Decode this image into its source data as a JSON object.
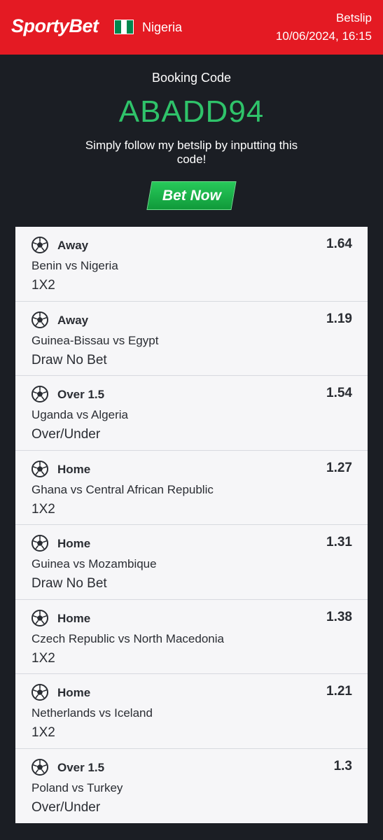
{
  "header": {
    "logo": "SportyBet",
    "country": "Nigeria",
    "title": "Betslip",
    "datetime": "10/06/2024, 16:15"
  },
  "booking": {
    "label": "Booking Code",
    "code": "ABADD94",
    "description": "Simply follow my betslip by inputting this code!",
    "button_label": "Bet Now"
  },
  "colors": {
    "brand_red": "#e41a23",
    "code_green": "#2fc36a",
    "background": "#1b1e24"
  },
  "bets": [
    {
      "pick": "Away",
      "odds": "1.64",
      "match": "Benin vs Nigeria",
      "market": "1X2"
    },
    {
      "pick": "Away",
      "odds": "1.19",
      "match": "Guinea-Bissau vs Egypt",
      "market": "Draw No Bet"
    },
    {
      "pick": "Over 1.5",
      "odds": "1.54",
      "match": "Uganda vs Algeria",
      "market": "Over/Under"
    },
    {
      "pick": "Home",
      "odds": "1.27",
      "match": "Ghana vs Central African Republic",
      "market": "1X2"
    },
    {
      "pick": "Home",
      "odds": "1.31",
      "match": "Guinea vs Mozambique",
      "market": "Draw No Bet"
    },
    {
      "pick": "Home",
      "odds": "1.38",
      "match": "Czech Republic vs North Macedonia",
      "market": "1X2"
    },
    {
      "pick": "Home",
      "odds": "1.21",
      "match": "Netherlands vs Iceland",
      "market": "1X2"
    },
    {
      "pick": "Over 1.5",
      "odds": "1.3",
      "match": "Poland vs Turkey",
      "market": "Over/Under"
    }
  ]
}
